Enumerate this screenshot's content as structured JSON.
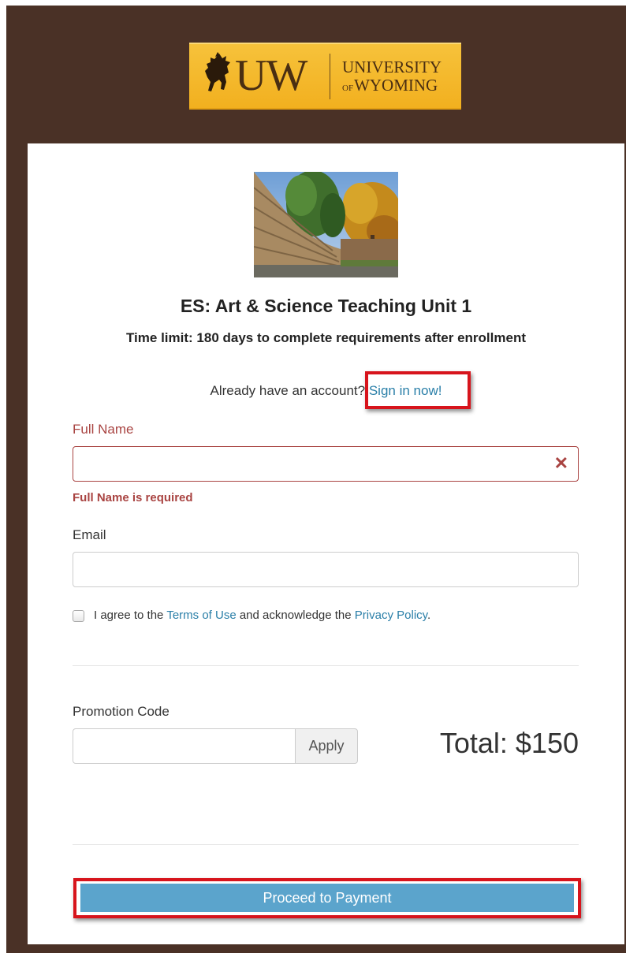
{
  "header": {
    "logo_uw": "UW",
    "logo_university": "UNIVERSITY",
    "logo_of": "OF",
    "logo_wyoming": "WYOMING",
    "brand_color": "#4a3126",
    "logo_color": "#f2b01f"
  },
  "course": {
    "image_icon": "campus-photo",
    "title": "ES: Art & Science Teaching Unit 1",
    "time_limit": "Time limit: 180 days to complete requirements after enrollment"
  },
  "signin": {
    "prompt": "Already have an account?",
    "link_label": "Sign in now!"
  },
  "form": {
    "full_name_label": "Full Name",
    "full_name_value": "",
    "full_name_error": "Full Name is required",
    "error_icon": "close-icon",
    "email_label": "Email",
    "email_value": "",
    "agree_prefix": "I agree to the",
    "terms_link": "Terms of Use",
    "agree_middle": "and acknowledge the",
    "privacy_link": "Privacy Policy",
    "agree_suffix": "."
  },
  "promo": {
    "label": "Promotion Code",
    "value": "",
    "apply_label": "Apply"
  },
  "total": "Total: $150",
  "proceed_label": "Proceed to Payment",
  "colors": {
    "error": "#a94442",
    "link": "#2a7fa8",
    "primary_button": "#5ba4cc",
    "highlight": "#d7141c"
  }
}
